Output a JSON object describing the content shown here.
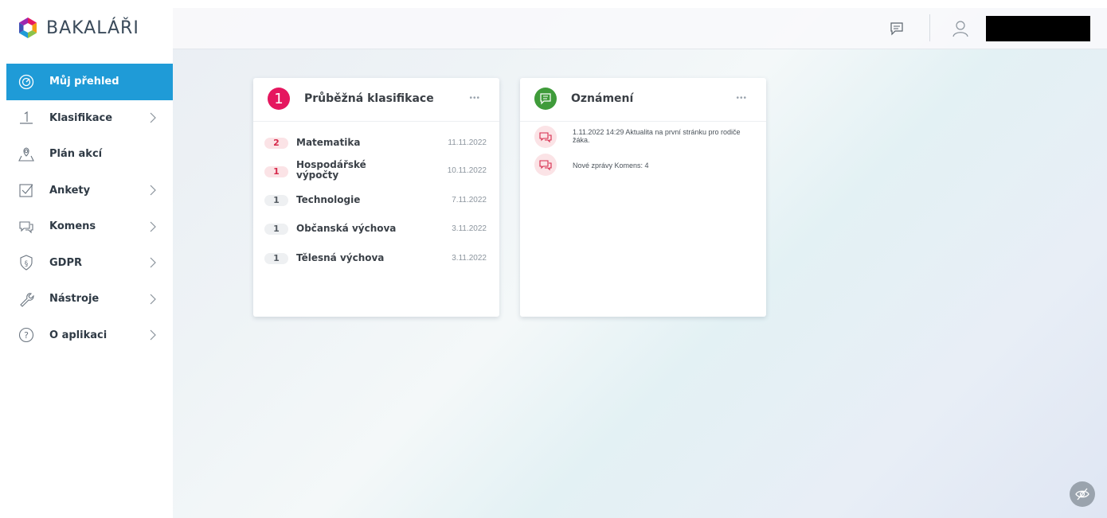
{
  "app": {
    "name": "BAKALÁŘI",
    "accent_color": "#1f9bd7"
  },
  "sidebar": {
    "items": [
      {
        "label": "Můj přehled",
        "icon": "target-icon",
        "active": true,
        "has_chevron": false
      },
      {
        "label": "Klasifikace",
        "icon": "grade-one-icon",
        "active": false,
        "has_chevron": true
      },
      {
        "label": "Plán akcí",
        "icon": "map-pin-icon",
        "active": false,
        "has_chevron": false
      },
      {
        "label": "Ankety",
        "icon": "checkbox-icon",
        "active": false,
        "has_chevron": true
      },
      {
        "label": "Komens",
        "icon": "chat-bubbles-icon",
        "active": false,
        "has_chevron": true
      },
      {
        "label": "GDPR",
        "icon": "shield-paragraph-icon",
        "active": false,
        "has_chevron": true
      },
      {
        "label": "Nástroje",
        "icon": "wrench-icon",
        "active": false,
        "has_chevron": true
      },
      {
        "label": "O aplikaci",
        "icon": "question-icon",
        "active": false,
        "has_chevron": true
      }
    ]
  },
  "topbar": {
    "messages_icon": "message-icon",
    "user_icon": "user-icon"
  },
  "cards": {
    "grades": {
      "title": "Průběžná klasifikace",
      "icon_text": "1",
      "icon_color": "#e5175f",
      "menu": "•••",
      "rows": [
        {
          "grade": "2",
          "subject": "Matematika",
          "date": "11.11.2022",
          "style": "red"
        },
        {
          "grade": "1",
          "subject": "Hospodářské výpočty",
          "date": "10.11.2022",
          "style": "red"
        },
        {
          "grade": "1",
          "subject": "Technologie",
          "date": "7.11.2022",
          "style": "grey"
        },
        {
          "grade": "1",
          "subject": "Občanská výchova",
          "date": "3.11.2022",
          "style": "grey"
        },
        {
          "grade": "1",
          "subject": "Tělesná výchova",
          "date": "3.11.2022",
          "style": "grey"
        }
      ]
    },
    "notices": {
      "title": "Oznámení",
      "icon_color": "#3f9b3a",
      "menu": "•••",
      "rows": [
        {
          "text": "1.11.2022 14:29 Aktualita na první stránku pro rodiče žáka."
        },
        {
          "text": "Nové zprávy Komens: 4"
        }
      ]
    }
  }
}
